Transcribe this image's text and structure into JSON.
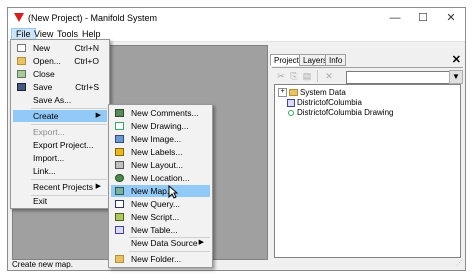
{
  "window": {
    "title": "(New Project) - Manifold System"
  },
  "controls": {
    "minimize": "—",
    "maximize": "☐",
    "close": "✕"
  },
  "menubar": [
    {
      "label": "File"
    },
    {
      "label": "View"
    },
    {
      "label": "Tools"
    },
    {
      "label": "Help"
    }
  ],
  "file_menu": {
    "new": {
      "label": "New",
      "shortcut": "Ctrl+N"
    },
    "open": {
      "label": "Open...",
      "shortcut": "Ctrl+O"
    },
    "close": {
      "label": "Close"
    },
    "save": {
      "label": "Save",
      "shortcut": "Ctrl+S"
    },
    "save_as": {
      "label": "Save As..."
    },
    "create": {
      "label": "Create"
    },
    "export": {
      "label": "Export..."
    },
    "export_project": {
      "label": "Export Project..."
    },
    "import": {
      "label": "Import..."
    },
    "link": {
      "label": "Link..."
    },
    "recent": {
      "label": "Recent Projects"
    },
    "exit": {
      "label": "Exit"
    }
  },
  "create_menu": {
    "comments": {
      "label": "New Comments..."
    },
    "drawing": {
      "label": "New Drawing..."
    },
    "image": {
      "label": "New Image..."
    },
    "labels": {
      "label": "New Labels..."
    },
    "layout": {
      "label": "New Layout..."
    },
    "location": {
      "label": "New Location..."
    },
    "map": {
      "label": "New Map..."
    },
    "query": {
      "label": "New Query..."
    },
    "script": {
      "label": "New Script..."
    },
    "table": {
      "label": "New Table..."
    },
    "data_source": {
      "label": "New Data Source"
    },
    "folder": {
      "label": "New Folder..."
    }
  },
  "panel": {
    "tabs": [
      {
        "label": "Project"
      },
      {
        "label": "Layers"
      },
      {
        "label": "Info"
      }
    ],
    "tree": [
      {
        "label": "System Data"
      },
      {
        "label": "DistrictofColumbia"
      },
      {
        "label": "DistrictofColumbia Drawing"
      }
    ]
  },
  "status": {
    "text": "Create new map."
  },
  "colors": {
    "highlight": "#91c9f7",
    "menu_bg": "#f2f2f2",
    "client_bg": "#a0a0a0",
    "accent_red": "#d62020"
  }
}
